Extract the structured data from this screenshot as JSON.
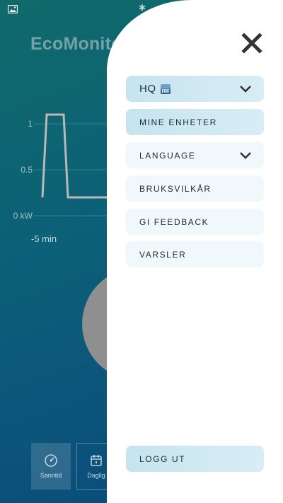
{
  "app": {
    "title": "EcoMonitor"
  },
  "chart_data": {
    "type": "line",
    "y_ticks": [
      "1",
      "0.5",
      "0 kW"
    ],
    "x_tick": "-5 min",
    "ylim": [
      0,
      1.2
    ],
    "series": [
      {
        "values": [
          [
            0,
            0.2
          ],
          [
            0.05,
            1.1
          ],
          [
            0.25,
            1.1
          ],
          [
            0.3,
            0.2
          ],
          [
            1,
            0.2
          ]
        ]
      }
    ]
  },
  "nav": {
    "tabs": [
      {
        "label": "Sanntid",
        "icon": "gauge-icon"
      },
      {
        "label": "Daglig",
        "icon": "calendar-icon"
      }
    ]
  },
  "drawer": {
    "close_icon": "close-icon",
    "items": [
      {
        "label": "HQ",
        "icon": "cityscape-emoji"
      },
      {
        "label": "MINE ENHETER"
      },
      {
        "label": "LANGUAGE"
      },
      {
        "label": "BRUKSVILKÅR"
      },
      {
        "label": "GI FEEDBACK"
      },
      {
        "label": "VARSLER"
      }
    ],
    "logout_label": "LOGG UT"
  },
  "colors": {
    "bg_top": "#0f6a6a",
    "bg_bottom": "#0a4a7c",
    "menu_strong": "#c6e4ee",
    "menu_light": "#f1f8fb",
    "close": "#333333"
  }
}
